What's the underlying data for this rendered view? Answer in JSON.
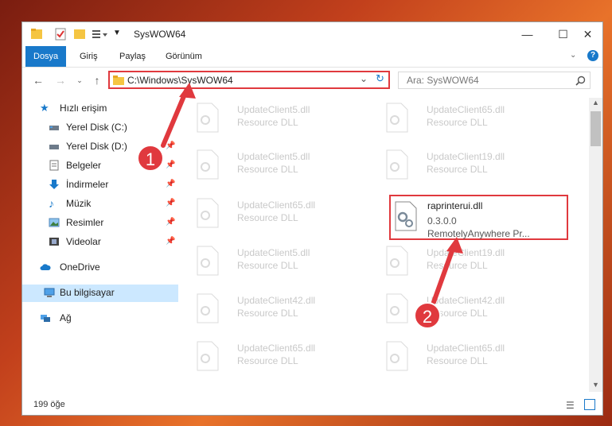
{
  "window": {
    "title": "SysWOW64"
  },
  "controls": {
    "minimize": "—",
    "maximize": "☐",
    "close": "✕"
  },
  "ribbon": {
    "tabs": [
      "Dosya",
      "Giriş",
      "Paylaş",
      "Görünüm"
    ]
  },
  "address": {
    "path": "C:\\Windows\\SysWOW64"
  },
  "search": {
    "placeholder": "Ara: SysWOW64"
  },
  "sidebar": {
    "items": [
      {
        "label": "Hızlı erişim",
        "icon": "star-icon"
      },
      {
        "label": "Yerel Disk (C:)",
        "icon": "drive-icon"
      },
      {
        "label": "Yerel Disk (D:)",
        "icon": "drive-icon"
      },
      {
        "label": "Belgeler",
        "icon": "documents-icon"
      },
      {
        "label": "İndirmeler",
        "icon": "download-icon"
      },
      {
        "label": "Müzik",
        "icon": "music-icon"
      },
      {
        "label": "Resimler",
        "icon": "pictures-icon"
      },
      {
        "label": "Videolar",
        "icon": "video-icon"
      },
      {
        "label": "OneDrive",
        "icon": "cloud-icon"
      },
      {
        "label": "Bu bilgisayar",
        "icon": "computer-icon"
      },
      {
        "label": "Ağ",
        "icon": "network-icon"
      }
    ]
  },
  "files": {
    "left": [
      {
        "name": "UpdateClient5.dll",
        "desc": "Resource DLL"
      },
      {
        "name": "UpdateClient5.dll",
        "desc": "Resource DLL"
      },
      {
        "name": "UpdateClient65.dll",
        "desc": "Resource DLL"
      },
      {
        "name": "UpdateClient5.dll",
        "desc": "Resource DLL"
      },
      {
        "name": "UpdateClient42.dll",
        "desc": "Resource DLL"
      },
      {
        "name": "UpdateClient65.dll",
        "desc": "Resource DLL"
      }
    ],
    "right": [
      {
        "name": "UpdateClient65.dll",
        "desc": "Resource DLL"
      },
      {
        "name": "UpdateClient19.dll",
        "desc": "Resource DLL"
      },
      {
        "name": "UpdateClient19.dll",
        "desc": "Resource DLL"
      },
      {
        "name": "UpdateClient42.dll",
        "desc": "Resource DLL"
      },
      {
        "name": "UpdateClient65.dll",
        "desc": "Resource DLL"
      }
    ],
    "highlighted": {
      "name": "raprinterui.dll",
      "version": "0.3.0.0",
      "company": "RemotelyAnywhere Pr..."
    }
  },
  "status": {
    "count": "199 öğe"
  },
  "annotations": {
    "step1": "1",
    "step2": "2"
  },
  "colors": {
    "accent": "#1979ca",
    "highlight": "#e0393e"
  }
}
